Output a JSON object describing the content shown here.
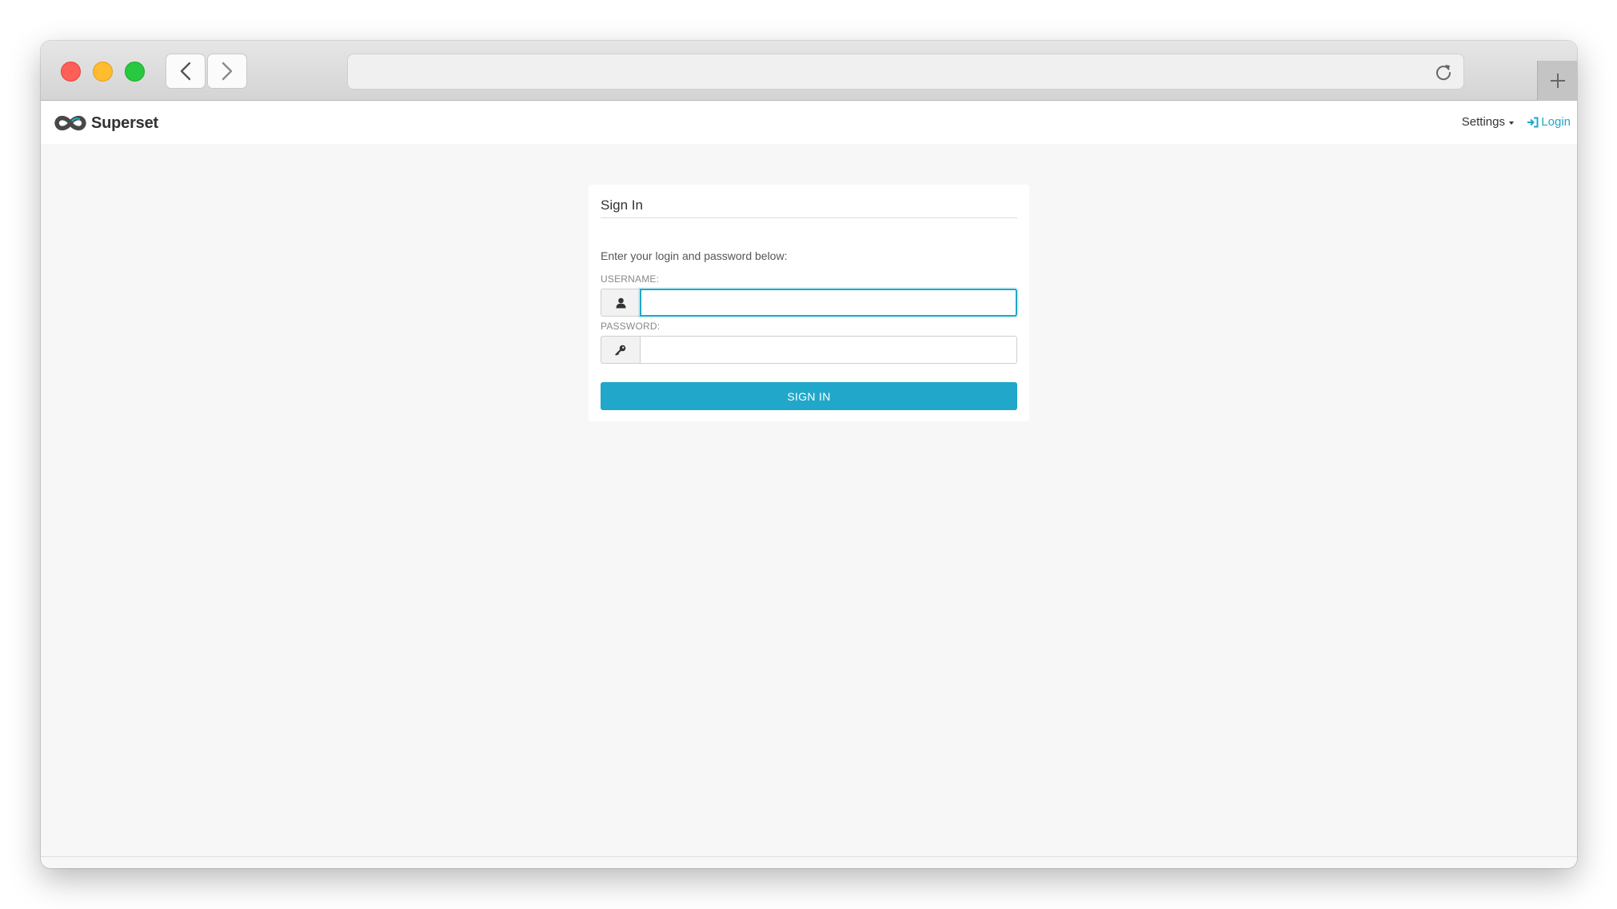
{
  "browser": {
    "url": "",
    "back_icon": "chevron-left-icon",
    "forward_icon": "chevron-right-icon",
    "reload_icon": "reload-icon",
    "new_tab_icon": "plus-icon"
  },
  "navbar": {
    "brand": "Superset",
    "brand_logo": "superset-logo",
    "settings_label": "Settings",
    "login_label": "Login",
    "login_icon": "sign-in-icon"
  },
  "signin": {
    "title": "Sign In",
    "instructions": "Enter your login and password below:",
    "username_label": "USERNAME:",
    "username_value": "",
    "username_icon": "user-icon",
    "password_label": "PASSWORD:",
    "password_value": "",
    "password_icon": "key-icon",
    "button_label": "SIGN IN"
  },
  "colors": {
    "accent": "#20a7c9",
    "background": "#f7f7f7",
    "panel": "#ffffff"
  }
}
